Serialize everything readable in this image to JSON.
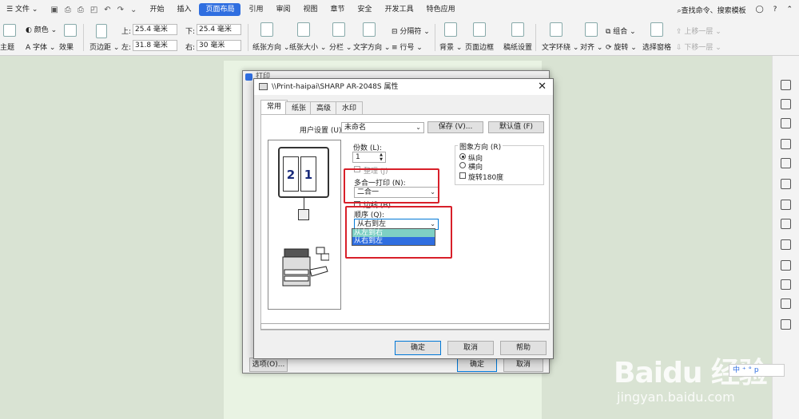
{
  "menubar": {
    "file": "文件",
    "tabs": [
      "开始",
      "插入",
      "页面布局",
      "引用",
      "审阅",
      "视图",
      "章节",
      "安全",
      "开发工具",
      "特色应用"
    ],
    "active_tab": "页面布局",
    "search": "查找命令、搜索模板"
  },
  "ribbon": {
    "theme": "主题",
    "color": "颜色",
    "font": "字体",
    "effect": "效果",
    "margin": "页边距",
    "top_label": "上:",
    "top_value": "25.4 毫米",
    "bottom_label": "下:",
    "bottom_value": "25.4 毫米",
    "left_label": "左:",
    "left_value": "31.8 毫米",
    "right_label": "右:",
    "right_value": "30 毫米",
    "orientation": "纸张方向",
    "size": "纸张大小",
    "columns": "分栏",
    "text_direction": "文字方向",
    "breaks": "分隔符",
    "line_numbers": "行号",
    "background": "背景",
    "page_border": "页面边框",
    "paper_setup": "稿纸设置",
    "wrap": "文字环绕",
    "align": "对齐",
    "rotate": "旋转",
    "group": "组合",
    "selection_pane": "选择窗格",
    "bring_forward": "上移一层",
    "send_backward": "下移一层"
  },
  "print_dialog": {
    "title": "打印",
    "options_button": "选项(O)...",
    "ok_button": "确定",
    "cancel_button": "取消"
  },
  "props_dialog": {
    "title": "\\\\Print-haipai\\SHARP AR-2048S 属性",
    "close": "✕",
    "tabs": [
      "常用",
      "纸张",
      "高级",
      "水印"
    ],
    "active_tab": "常用",
    "user_settings_label": "用户设置 (U):",
    "user_settings_value": "未命名",
    "save_button": "保存 (V)...",
    "defaults_button": "默认值 (F)",
    "copies_label": "份数 (L):",
    "copies_value": "1",
    "collate_label": "整理 (J)",
    "nup_label": "多合一打印 (N):",
    "nup_value": "二合一",
    "border_label": "边线 (B)",
    "order_label": "顺序 (Q):",
    "order_value": "从右到左",
    "order_options": [
      "从左到右",
      "从右到左"
    ],
    "orientation_label": "图象方向 (R)",
    "portrait": "纵向",
    "landscape": "横向",
    "rotate180": "旋转180度",
    "ok_button": "确定",
    "cancel_button": "取消",
    "help_button": "帮助",
    "preview_left": "2",
    "preview_right": "1"
  },
  "watermark": {
    "brand": "Baidu 经验",
    "url": "jingyan.baidu.com"
  },
  "ime": {
    "text": "中 ⁺ ° p"
  }
}
